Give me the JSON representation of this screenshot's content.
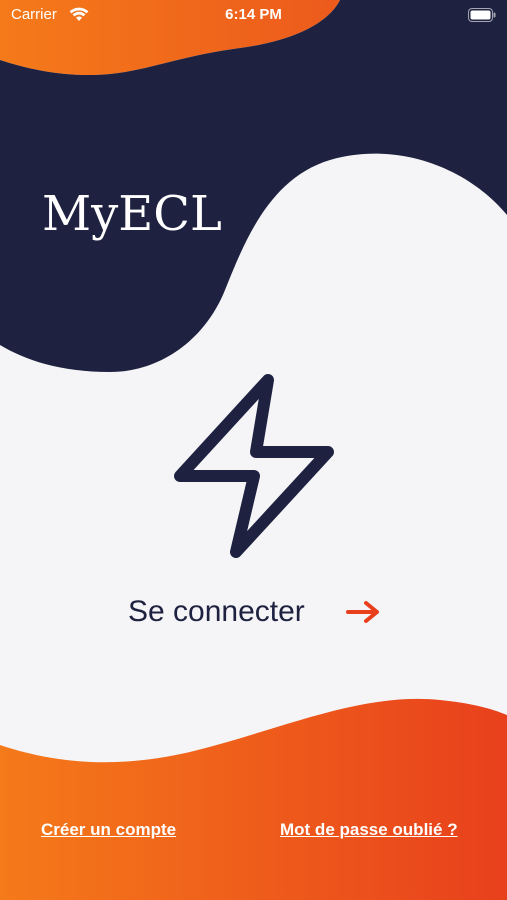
{
  "status_bar": {
    "carrier": "Carrier",
    "time": "6:14 PM",
    "wifi_icon": "wifi-icon",
    "battery_icon": "battery-icon"
  },
  "app": {
    "logo_text": "MyECL"
  },
  "main": {
    "hero_icon": "lightning-bolt-icon",
    "login_label": "Se connecter",
    "login_arrow_icon": "arrow-right-icon"
  },
  "footer": {
    "create_account_label": "Créer un compte",
    "forgot_password_label": "Mot de passe oublié ?"
  },
  "colors": {
    "navy": "#1e2240",
    "orange": "#f26d1e",
    "orange_red": "#e8401c",
    "background": "#f5f5f7"
  }
}
